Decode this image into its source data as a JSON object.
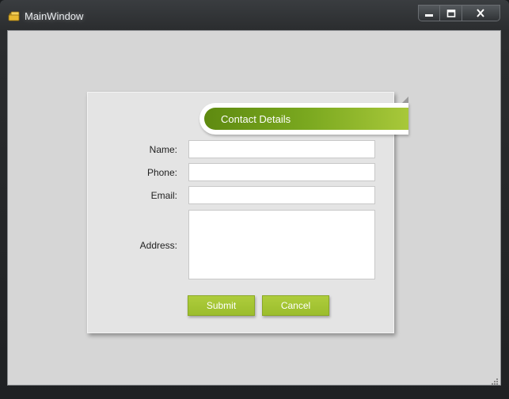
{
  "window": {
    "title": "MainWindow",
    "icon": "app-folder-icon",
    "caption_buttons": [
      "minimize-icon",
      "maximize-icon",
      "close-icon"
    ]
  },
  "form": {
    "header": "Contact Details",
    "fields": {
      "name": {
        "label": "Name:",
        "value": ""
      },
      "phone": {
        "label": "Phone:",
        "value": ""
      },
      "email": {
        "label": "Email:",
        "value": ""
      },
      "address": {
        "label": "Address:",
        "value": ""
      }
    },
    "buttons": {
      "submit": "Submit",
      "cancel": "Cancel"
    }
  },
  "colors": {
    "accent_green": "#9bbd2c",
    "ribbon_green_dark": "#5e8a10",
    "client_bg": "#d6d6d6"
  }
}
